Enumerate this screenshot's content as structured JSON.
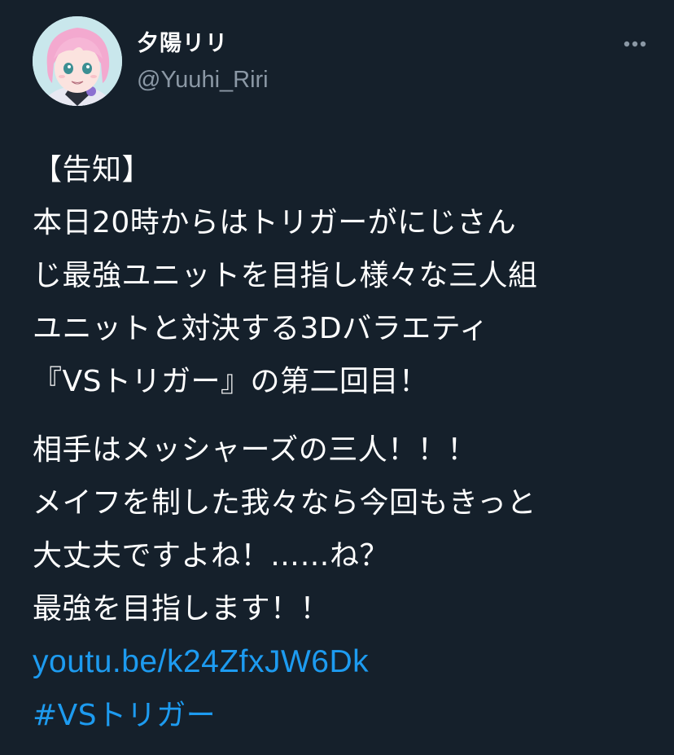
{
  "user": {
    "display_name": "夕陽リリ",
    "handle": "@Yuuhi_Riri",
    "avatar_icon": "user-avatar"
  },
  "actions": {
    "more_icon": "more-horizontal-icon"
  },
  "tweet": {
    "paragraph1": [
      "【告知】",
      "本日20時からはトリガーがにじさん",
      "じ最強ユニットを目指し様々な三人組",
      "ユニットと対決する3Dバラエティ",
      "『VSトリガー』の第二回目！"
    ],
    "paragraph2": [
      "相手はメッシャーズの三人！！！",
      "メイフを制した我々なら今回もきっと",
      "大丈夫ですよね！……ね？",
      "最強を目指します！！"
    ],
    "link": "youtu.be/k24ZfxJW6Dk",
    "hashtag": "#VSトリガー"
  },
  "colors": {
    "background": "#15202b",
    "text": "#ffffff",
    "secondary": "#8b98a5",
    "link": "#1d9bf0"
  }
}
